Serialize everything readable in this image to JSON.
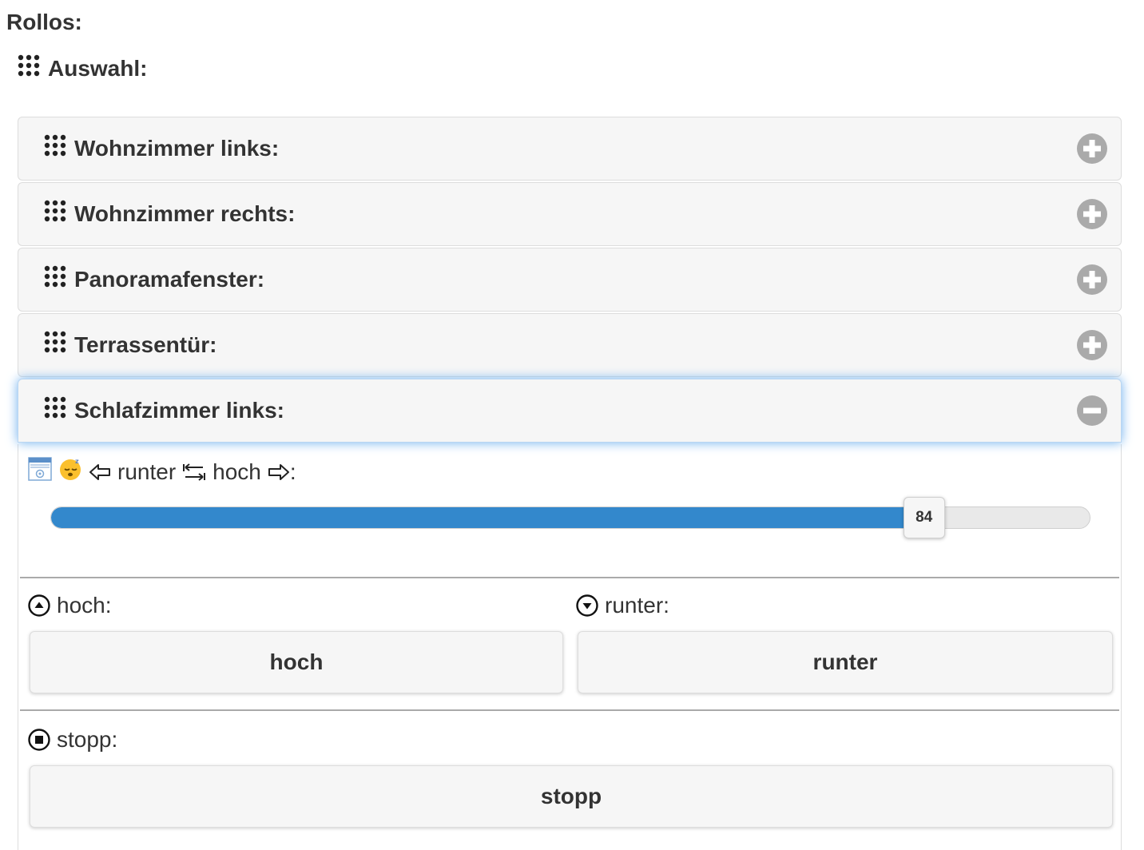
{
  "page": {
    "title": "Rollos:"
  },
  "section": {
    "icon": "grid-icon",
    "title": "Auswahl:"
  },
  "accordion": {
    "items": [
      {
        "label": "Wohnzimmer links:",
        "icon": "grid-icon",
        "toggle_icon": "plus-circle-icon",
        "expanded": false
      },
      {
        "label": "Wohnzimmer rechts:",
        "icon": "grid-icon",
        "toggle_icon": "plus-circle-icon",
        "expanded": false
      },
      {
        "label": "Panoramafenster:",
        "icon": "grid-icon",
        "toggle_icon": "plus-circle-icon",
        "expanded": false
      },
      {
        "label": "Terrassentür:",
        "icon": "grid-icon",
        "toggle_icon": "plus-circle-icon",
        "expanded": false
      },
      {
        "label": "Schlafzimmer links:",
        "icon": "grid-icon",
        "toggle_icon": "minus-circle-icon",
        "expanded": true
      }
    ]
  },
  "panel": {
    "slider": {
      "label_runter": "runter",
      "label_hoch": "hoch",
      "label_suffix": ":",
      "icons": [
        "window-blind-icon",
        "sleeping-face-icon",
        "arrow-left-icon",
        "arrows-left-right-icon",
        "arrow-right-icon"
      ],
      "value": 84,
      "value_text": "84",
      "min": 0,
      "max": 100
    },
    "hoch": {
      "label": "hoch:",
      "icon": "circle-up-icon",
      "button_label": "hoch"
    },
    "runter": {
      "label": "runter:",
      "icon": "circle-down-icon",
      "button_label": "runter"
    },
    "stopp": {
      "label": "stopp:",
      "icon": "circle-stop-icon",
      "button_label": "stopp"
    }
  },
  "colors": {
    "accent": "#3388cc",
    "header_bg": "#f6f6f6",
    "text": "#333333",
    "toggle_icon": "#aaaaaa",
    "focus_glow": "#6fb0ee"
  }
}
